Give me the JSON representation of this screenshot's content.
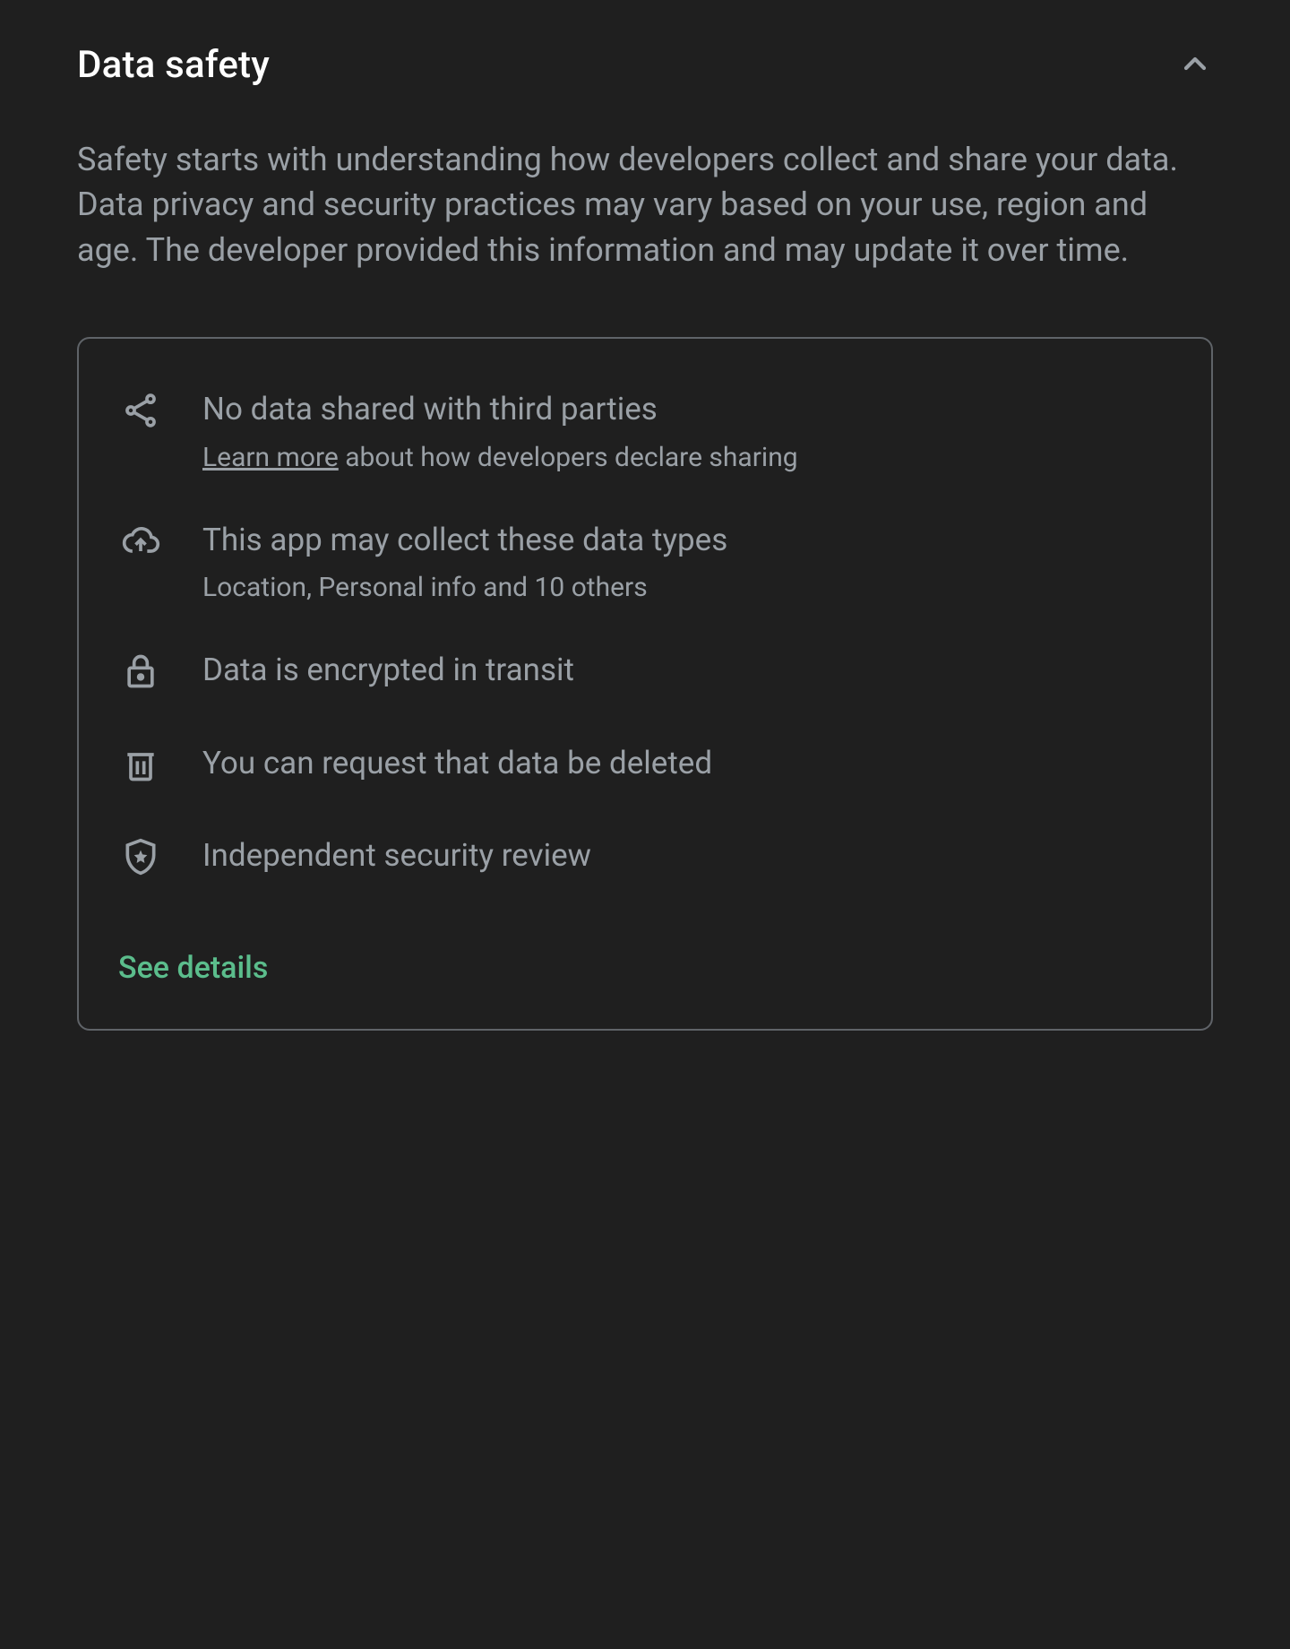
{
  "header": {
    "title": "Data safety"
  },
  "description": "Safety starts with understanding how developers collect and share your data. Data privacy and security practices may vary based on your use, region and age. The developer provided this information and may update it over time.",
  "items": [
    {
      "heading": "No data shared with third parties",
      "link_text": "Learn more",
      "sub_rest": " about how developers declare sharing"
    },
    {
      "heading": "This app may collect these data types",
      "sub": "Location, Personal info and 10 others"
    },
    {
      "heading": "Data is encrypted in transit"
    },
    {
      "heading": "You can request that data be deleted"
    },
    {
      "heading": "Independent security review"
    }
  ],
  "see_details": "See details"
}
